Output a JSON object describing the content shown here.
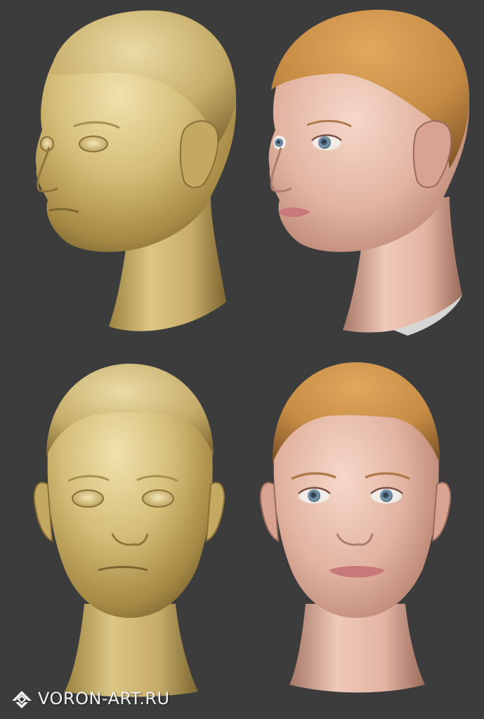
{
  "image": {
    "background_color": "#3c3c3d",
    "palette": {
      "clay_light": "#e9d9a0",
      "clay_mid": "#c9b06a",
      "clay_dark": "#6e5a2c",
      "skin_light": "#f3cfc0",
      "skin_mid": "#dca894",
      "skin_dark": "#8a5e52",
      "hair": "#c68c44",
      "iris": "#6f8fa8",
      "lips": "#c9787a"
    },
    "panels": [
      {
        "id": "top-left",
        "subject": "clay-sculpt-head",
        "view": "three-quarter"
      },
      {
        "id": "top-right",
        "subject": "textured-head",
        "view": "three-quarter"
      },
      {
        "id": "bottom-left",
        "subject": "clay-sculpt-head",
        "view": "front"
      },
      {
        "id": "bottom-right",
        "subject": "textured-head",
        "view": "front"
      }
    ]
  },
  "watermark": {
    "text": "VORON-ART.RU",
    "logo_icon": "voron-art-logo-icon"
  }
}
